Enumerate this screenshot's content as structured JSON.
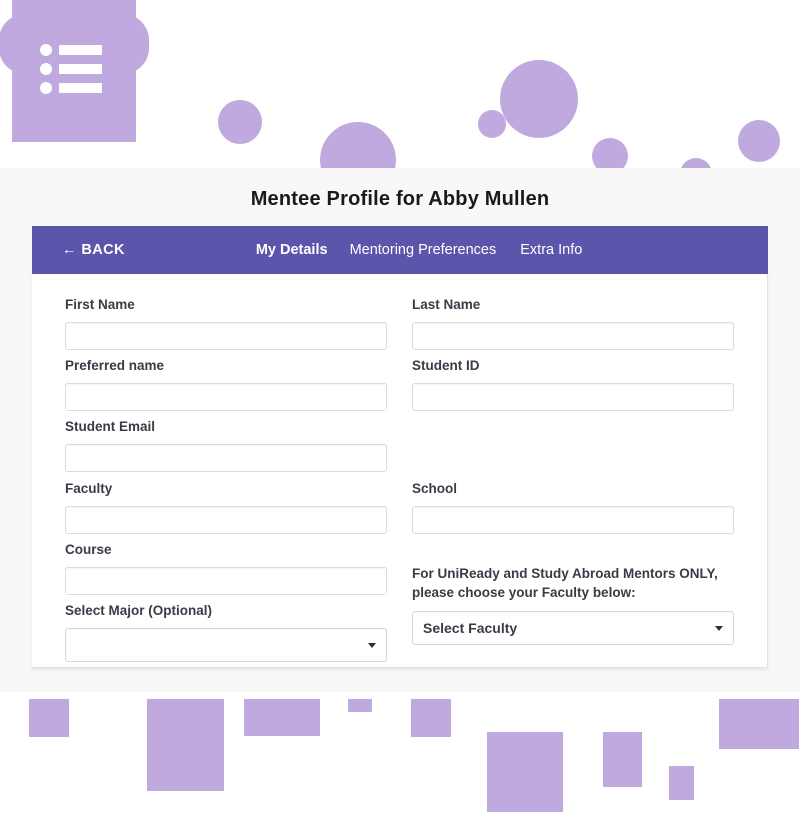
{
  "page": {
    "title": "Mentee Profile for Abby Mullen"
  },
  "decor": {
    "menu_icon": "list-icon",
    "accent_light": "#bfa9df",
    "accent_dark": "#5b55ac",
    "panel_bg": "#f8f8f9",
    "card_bg": "#ffffff"
  },
  "nav": {
    "back_label": "← BACK",
    "tabs": [
      {
        "label": "My Details",
        "active": true
      },
      {
        "label": "Mentoring Preferences",
        "active": false
      },
      {
        "label": "Extra Info",
        "active": false
      }
    ]
  },
  "form": {
    "left": [
      {
        "label": "First Name",
        "value": "",
        "placeholder": "",
        "type": "text"
      },
      {
        "label": "Preferred name",
        "value": "",
        "placeholder": "",
        "type": "text"
      },
      {
        "label": "Student Email",
        "value": "",
        "placeholder": "",
        "type": "text"
      },
      {
        "label": "Faculty",
        "value": "",
        "placeholder": "",
        "type": "text"
      },
      {
        "label": "Course",
        "value": "",
        "placeholder": "",
        "type": "text"
      },
      {
        "label": "Select Major (Optional)",
        "value": "",
        "placeholder": "",
        "type": "select"
      }
    ],
    "right": [
      {
        "label": "Last Name",
        "value": "",
        "placeholder": "",
        "type": "text"
      },
      {
        "label": "Student ID",
        "value": "",
        "placeholder": "",
        "type": "text"
      },
      {
        "label": "School",
        "value": "",
        "placeholder": "",
        "type": "text"
      }
    ],
    "uniready": {
      "note": "For UniReady and Study Abroad Mentors ONLY, please choose your Faculty below:",
      "select_value": "Select Faculty"
    }
  }
}
